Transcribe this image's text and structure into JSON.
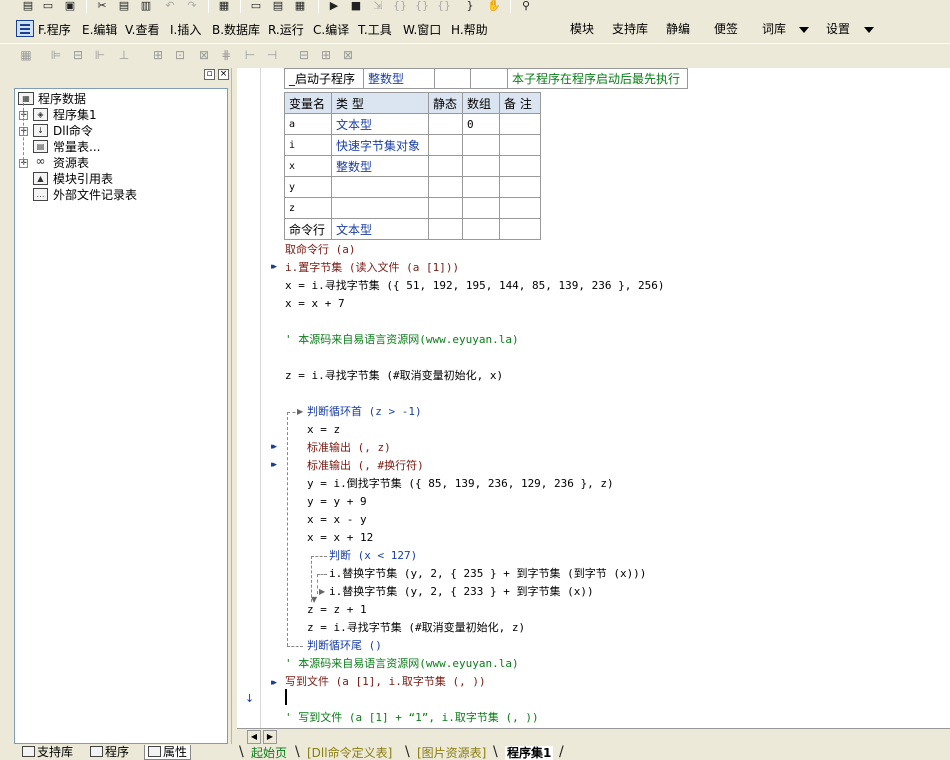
{
  "toolbar": {
    "icons": [
      "new-doc-icon",
      "open-folder-icon",
      "save-icon",
      "cut-icon",
      "copy-icon",
      "paste-icon",
      "undo-icon",
      "redo-icon",
      "print-preview-icon",
      "layout-1-icon",
      "layout-2-icon",
      "layout-3-icon",
      "run-icon",
      "stop-icon",
      "step-icon",
      "step-into-icon",
      "step-out-icon",
      "step-over-icon",
      "hand-icon",
      "find-icon"
    ]
  },
  "menu": {
    "items": [
      "F.程序",
      "E.编辑",
      "V.查看",
      "I.插入",
      "B.数据库",
      "R.运行",
      "C.编译",
      "T.工具",
      "W.窗口",
      "H.帮助"
    ],
    "right": [
      "模块",
      "支持库",
      "静编",
      "便签",
      "词库",
      "设置"
    ]
  },
  "tree": {
    "root": "程序数据",
    "items": [
      "程序集1",
      "Dll命令",
      "常量表...",
      "资源表",
      "模块引用表",
      "外部文件记录表"
    ]
  },
  "bottom_tabs": [
    "支持库",
    "程序",
    "属性"
  ],
  "subroutine": {
    "name": "_启动子程序",
    "return_type": "整数型",
    "note": "本子程序在程序启动后最先执行"
  },
  "var_table": {
    "headers": [
      "变量名",
      "类 型",
      "静态",
      "数组",
      "备 注"
    ],
    "rows": [
      {
        "name": "a",
        "type": "文本型",
        "static": "",
        "array": "0",
        "note": ""
      },
      {
        "name": "i",
        "type": "快速字节集对象",
        "static": "",
        "array": "",
        "note": ""
      },
      {
        "name": "x",
        "type": "整数型",
        "static": "",
        "array": "",
        "note": ""
      },
      {
        "name": "y",
        "type": "",
        "static": "",
        "array": "",
        "note": ""
      },
      {
        "name": "z",
        "type": "",
        "static": "",
        "array": "",
        "note": ""
      },
      {
        "name": "命令行",
        "type": "文本型",
        "static": "",
        "array": "",
        "note": ""
      }
    ]
  },
  "code": {
    "l1": "取命令行 (a)",
    "l2": "i.置字节集 (读入文件 (a [1]))",
    "l3": "x = i.寻找字节集 ({ 51, 192, 195, 144, 85, 139, 236 }, 256)",
    "l4": "x = x + 7",
    "l5": "' 本源码来自易语言资源网(www.eyuyan.la)",
    "l6": "z = i.寻找字节集 (#取消变量初始化, x)",
    "l7": "判断循环首 (z > -1)",
    "l8": "x = z",
    "l9": "标准输出 (, z)",
    "l10": "标准输出 (, #换行符)",
    "l11": "y = i.倒找字节集 ({ 85, 139, 236, 129, 236 }, z)",
    "l12": "y = y + 9",
    "l13": "x = x - y",
    "l14": "x = x + 12",
    "l15": "判断 (x < 127)",
    "l16": "i.替换字节集 (y, 2, { 235 } + 到字节集 (到字节 (x)))",
    "l17": "i.替换字节集 (y, 2, { 233 } + 到字节集 (x))",
    "l18": "z = z + 1",
    "l19": "z = i.寻找字节集 (#取消变量初始化, z)",
    "l20": "判断循环尾 ()",
    "l21": "' 本源码来自易语言资源网(www.eyuyan.la)",
    "l22": "写到文件 (a [1], i.取字节集 (, ))",
    "l23": "' 写到文件 (a [1] + “1”, i.取字节集 (, ))"
  },
  "file_tabs": [
    "起始页",
    "[Dll命令定义表]",
    "[图片资源表]",
    "程序集1"
  ]
}
